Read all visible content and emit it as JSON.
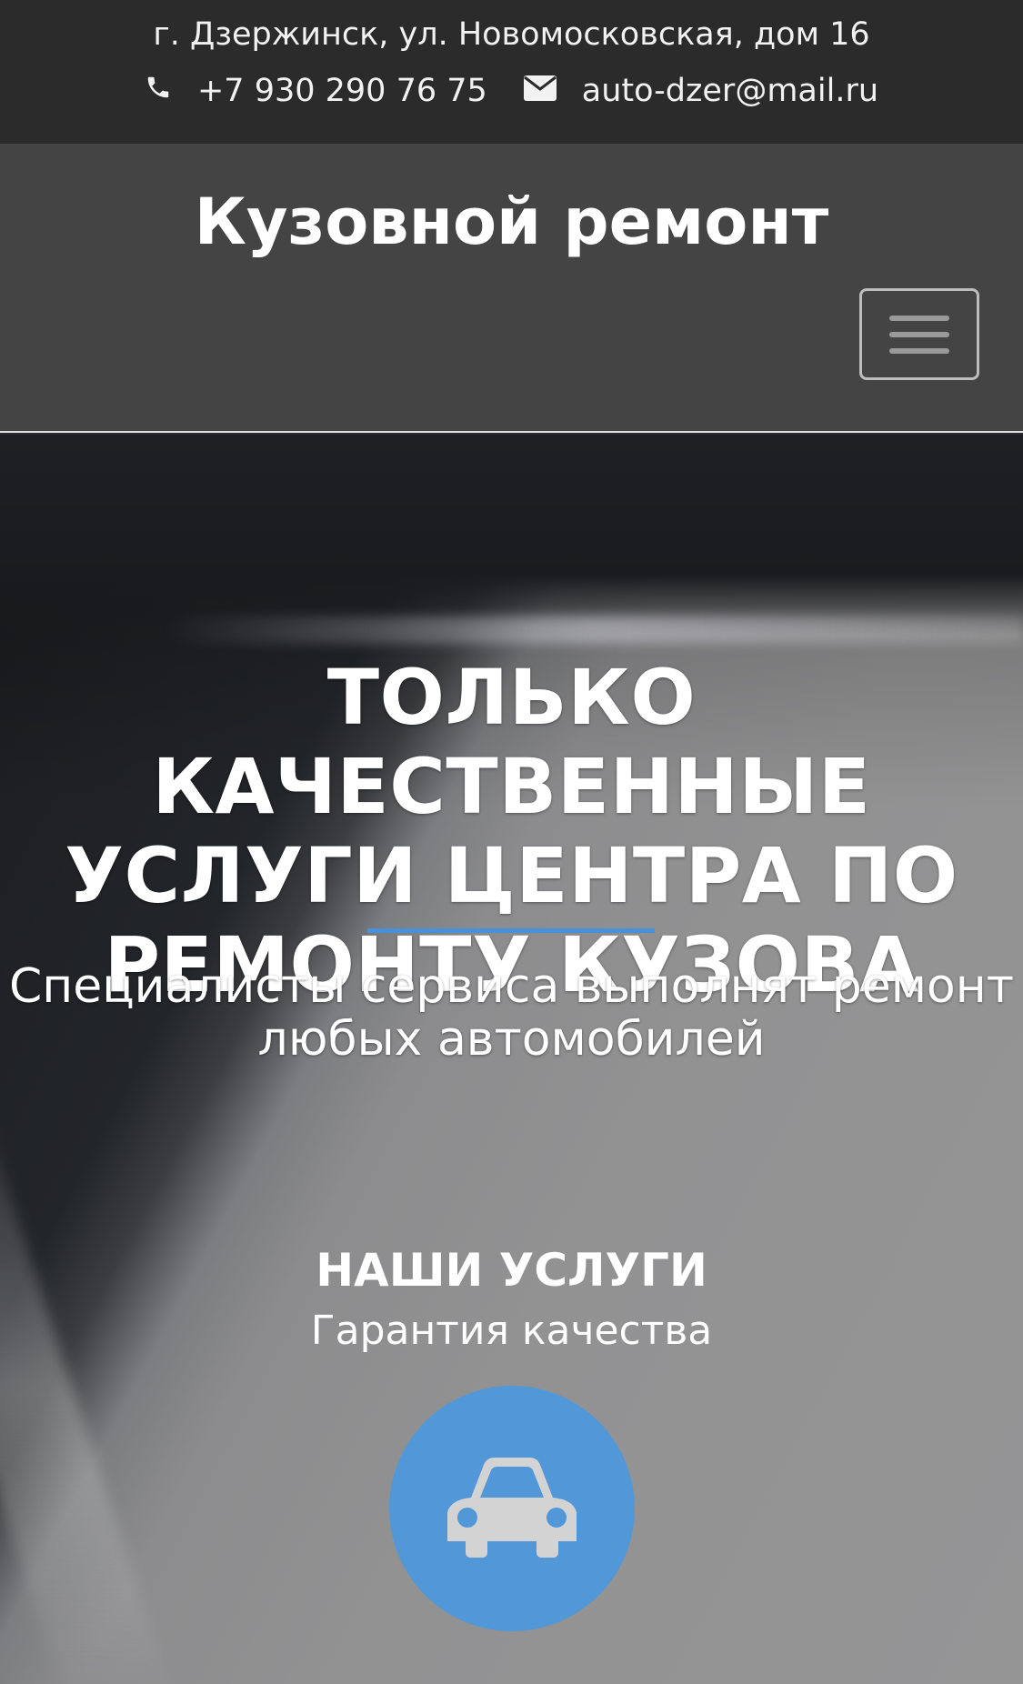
{
  "topbar": {
    "address": "г. Дзержинск, ул. Новомосковская, дом 16",
    "phone": "+7 930 290 76 75",
    "email": "auto-dzer@mail.ru",
    "phone_icon": "phone-icon",
    "email_icon": "envelope-icon"
  },
  "navbar": {
    "site_title": "Кузовной ремонт",
    "menu_icon": "hamburger-menu-icon"
  },
  "hero": {
    "title_lines": [
      "ТОЛЬКО КАЧЕСТВЕННЫЕ",
      "УСЛУГИ ЦЕНТРА ПО",
      "РЕМОНТУ КУЗОВА"
    ],
    "subtitle_lines": [
      "Специалисты сервиса выполнят ремонт",
      "любых автомобилей"
    ],
    "services_heading": "НАШИ УСЛУГИ",
    "services_subheading": "Гарантия качества",
    "service_icon": "car-icon"
  },
  "colors": {
    "accent": "#4a90d9",
    "circle": "#5297d7",
    "topbar_bg": "#2b2b2b",
    "navbar_bg": "#444444"
  }
}
